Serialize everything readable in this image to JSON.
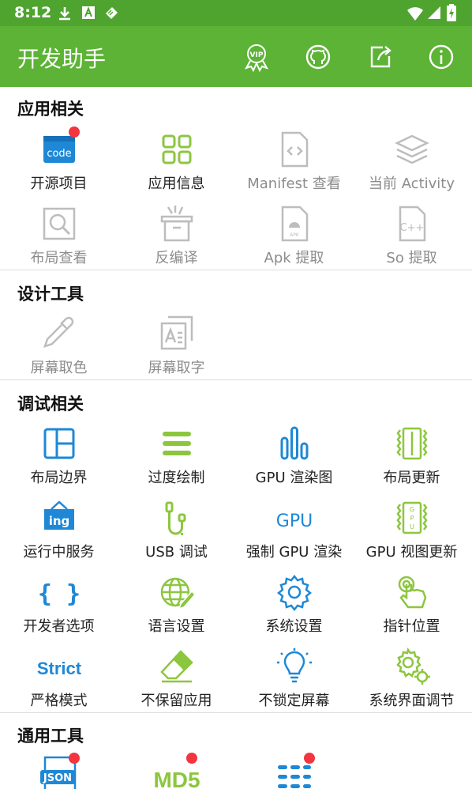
{
  "status": {
    "time": "8:12"
  },
  "appbar": {
    "title": "开发助手"
  },
  "sections": {
    "app": {
      "title": "应用相关"
    },
    "design": {
      "title": "设计工具"
    },
    "debug": {
      "title": "调试相关"
    },
    "general": {
      "title": "通用工具"
    }
  },
  "app_items": [
    {
      "label": "开源项目",
      "icon": "code-icon",
      "enabled": true,
      "badge": true
    },
    {
      "label": "应用信息",
      "icon": "grid-apps-icon",
      "enabled": true
    },
    {
      "label": "Manifest 查看",
      "icon": "manifest-file-icon",
      "enabled": false
    },
    {
      "label": "当前 Activity",
      "icon": "layers-icon",
      "enabled": false
    },
    {
      "label": "布局查看",
      "icon": "layout-inspect-icon",
      "enabled": false
    },
    {
      "label": "反编译",
      "icon": "decompile-box-icon",
      "enabled": false
    },
    {
      "label": "Apk 提取",
      "icon": "apk-file-icon",
      "enabled": false
    },
    {
      "label": "So 提取",
      "icon": "cpp-file-icon",
      "enabled": false
    }
  ],
  "design_items": [
    {
      "label": "屏幕取色",
      "icon": "eyedropper-icon",
      "enabled": false
    },
    {
      "label": "屏幕取字",
      "icon": "text-capture-icon",
      "enabled": false
    }
  ],
  "debug_items": [
    {
      "label": "布局边界",
      "icon": "layout-bounds-icon"
    },
    {
      "label": "过度绘制",
      "icon": "overdraw-icon"
    },
    {
      "label": "GPU 渲染图",
      "icon": "gpu-bars-icon"
    },
    {
      "label": "布局更新",
      "icon": "layout-update-icon"
    },
    {
      "label": "运行中服务",
      "icon": "running-services-icon",
      "icon_text": "ing"
    },
    {
      "label": "USB 调试",
      "icon": "usb-icon"
    },
    {
      "label": "强制 GPU 渲染",
      "icon": "gpu-text-icon",
      "icon_text": "GPU"
    },
    {
      "label": "GPU 视图更新",
      "icon": "gpu-view-update-icon"
    },
    {
      "label": "开发者选项",
      "icon": "braces-icon",
      "icon_text": "{ }"
    },
    {
      "label": "语言设置",
      "icon": "language-globe-icon"
    },
    {
      "label": "系统设置",
      "icon": "settings-gear-icon"
    },
    {
      "label": "指针位置",
      "icon": "pointer-touch-icon"
    },
    {
      "label": "严格模式",
      "icon": "strict-icon",
      "icon_text": "Strict"
    },
    {
      "label": "不保留应用",
      "icon": "eraser-icon"
    },
    {
      "label": "不锁定屏幕",
      "icon": "lightbulb-icon"
    },
    {
      "label": "系统界面调节",
      "icon": "gears-icon"
    }
  ],
  "general_items": [
    {
      "label": "",
      "icon": "json-icon",
      "icon_text": "JSON",
      "badge": true
    },
    {
      "label": "",
      "icon": "md5-icon",
      "icon_text": "MD5",
      "badge": true
    },
    {
      "label": "",
      "icon": "list-convert-icon",
      "badge": true
    }
  ],
  "colors": {
    "green": "#5cb335",
    "blue": "#1e88d6",
    "lime": "#8cc63f",
    "badge": "#f2353e",
    "gray": "#9e9e9e"
  }
}
